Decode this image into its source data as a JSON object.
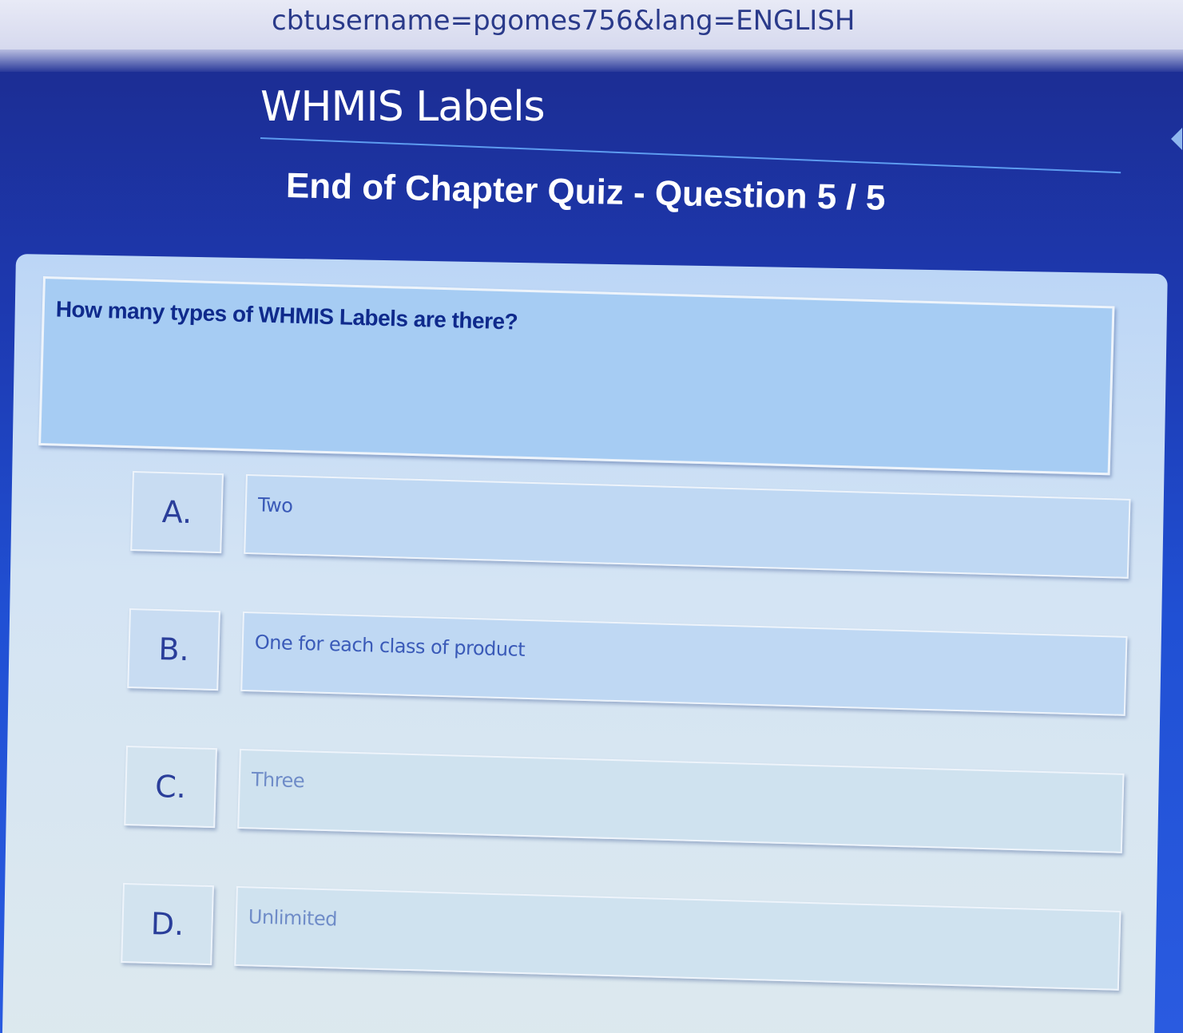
{
  "browser": {
    "url_fragment": "cbtusername=pgomes756&lang=ENGLISH"
  },
  "header": {
    "app_title": "WHMIS Labels",
    "quiz_title": "End of Chapter Quiz - Question 5 / 5"
  },
  "question": {
    "text": "How many types of WHMIS Labels are there?"
  },
  "answers": [
    {
      "letter": "A.",
      "text": "Two"
    },
    {
      "letter": "B.",
      "text": "One for each class of product"
    },
    {
      "letter": "C.",
      "text": "Three"
    },
    {
      "letter": "D.",
      "text": "Unlimited"
    }
  ],
  "colors": {
    "background_accent": "#2050d4",
    "panel": "#d4e4f4",
    "question_box": "#a6ccf3",
    "question_text": "#0f2a8c"
  }
}
